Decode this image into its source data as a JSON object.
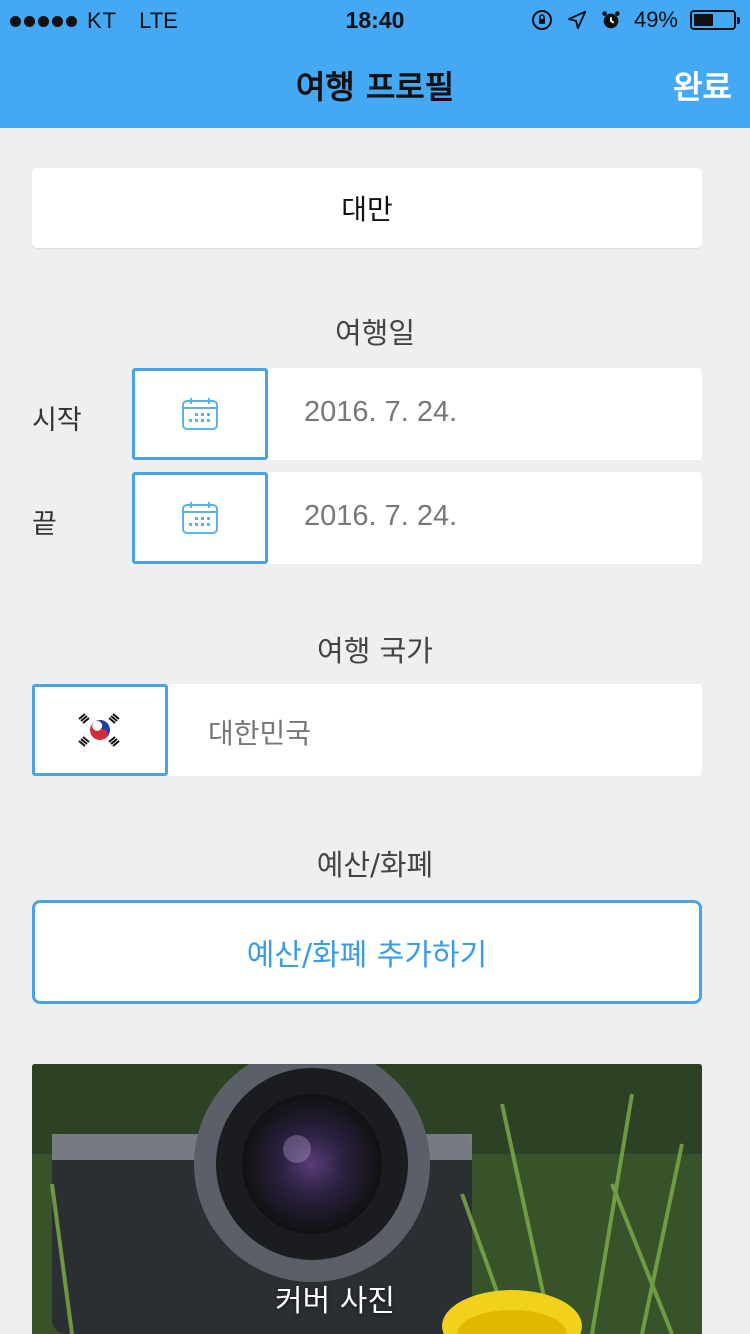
{
  "status_bar": {
    "carrier": "KT",
    "network": "LTE",
    "time": "18:40",
    "battery_percent_text": "49%",
    "battery_level": 0.49
  },
  "nav": {
    "title": "여행 프로필",
    "done_label": "완료"
  },
  "trip": {
    "name": "대만"
  },
  "dates": {
    "section_label": "여행일",
    "start_label": "시작",
    "start_value": "2016. 7. 24.",
    "end_label": "끝",
    "end_value": "2016. 7. 24."
  },
  "country": {
    "section_label": "여행 국가",
    "value": "대한민국",
    "flag_icon": "south-korea-flag-icon"
  },
  "budget": {
    "section_label": "예산/화폐",
    "add_button_label": "예산/화폐 추가하기"
  },
  "cover": {
    "label": "커버 사진"
  },
  "colors": {
    "nav_background": "#45a8f5",
    "accent": "#4aa3e4",
    "page_background": "#efefef"
  }
}
